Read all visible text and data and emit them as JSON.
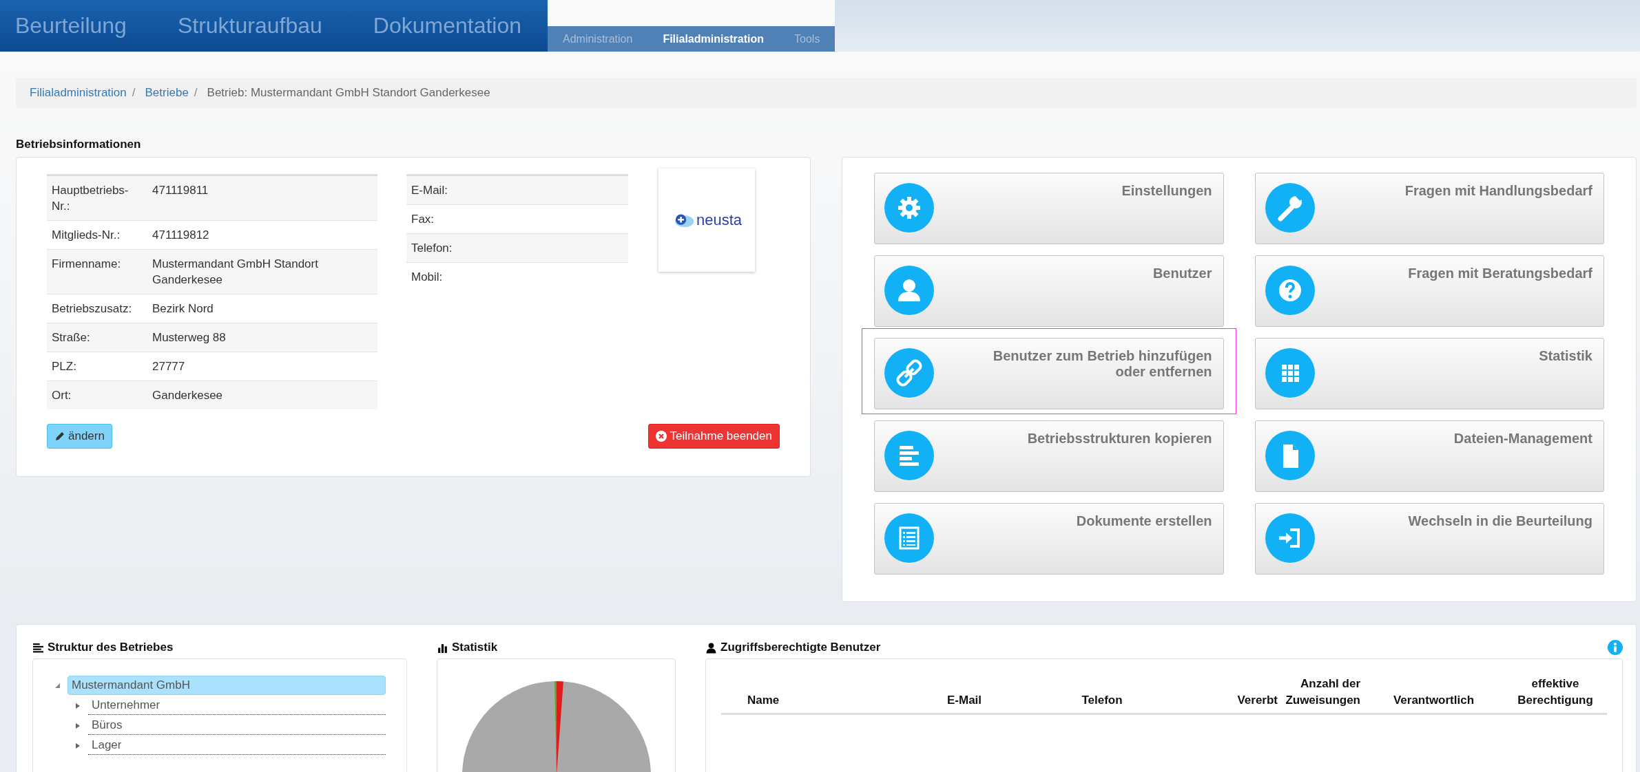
{
  "top_nav": [
    {
      "label": "Beurteilung",
      "selected": false
    },
    {
      "label": "Strukturaufbau",
      "selected": false
    },
    {
      "label": "Dokumentation",
      "selected": false
    }
  ],
  "sub_nav": [
    {
      "label": "Administration",
      "selected": false
    },
    {
      "label": "Filialadministration",
      "selected": true
    },
    {
      "label": "Tools",
      "selected": false
    }
  ],
  "breadcrumb": [
    {
      "label": "Filialadministration",
      "kind": "link"
    },
    {
      "label": "/",
      "kind": "separator"
    },
    {
      "label": "Betriebe",
      "kind": "link"
    },
    {
      "label": "/",
      "kind": "separator"
    },
    {
      "label": "Betrieb: Mustermandant GmbH Standort Ganderkesee",
      "kind": "current"
    }
  ],
  "info_section": {
    "title": "Betriebsinformationen",
    "left_fields": [
      {
        "label": "Hauptbetriebs-Nr.:",
        "value": "471119811"
      },
      {
        "label": "Mitglieds-Nr.:",
        "value": "471119812"
      },
      {
        "label": "Firmenname:",
        "value": "Mustermandant GmbH Standort Ganderkesee"
      },
      {
        "label": "Betriebszusatz:",
        "value": "Bezirk Nord"
      },
      {
        "label": "Straße:",
        "value": "Musterweg 88"
      },
      {
        "label": "PLZ:",
        "value": "27777"
      },
      {
        "label": "Ort:",
        "value": "Ganderkesee"
      }
    ],
    "right_fields": [
      {
        "label": "E-Mail:"
      },
      {
        "label": "Fax:"
      },
      {
        "label": "Telefon:"
      },
      {
        "label": "Mobil:"
      }
    ],
    "logo_text": "neusta",
    "edit_button": "ändern",
    "end_button": "Teilnahme beenden"
  },
  "tiles": [
    {
      "label": "Einstellungen",
      "kind": "gear",
      "highlighted": false
    },
    {
      "label": "Fragen mit Handlungsbedarf",
      "kind": "wrench",
      "highlighted": false
    },
    {
      "label": "Benutzer",
      "kind": "user",
      "highlighted": false
    },
    {
      "label": "Fragen mit Beratungsbedarf",
      "kind": "question",
      "highlighted": false
    },
    {
      "label": "Benutzer zum Betrieb hinzufügen oder entfernen",
      "kind": "link",
      "highlighted": true
    },
    {
      "label": "Statistik",
      "kind": "grid",
      "highlighted": false
    },
    {
      "label": "Betriebsstrukturen kopieren",
      "kind": "lines",
      "highlighted": false
    },
    {
      "label": "Dateien-Management",
      "kind": "file",
      "highlighted": false
    },
    {
      "label": "Dokumente erstellen",
      "kind": "list",
      "highlighted": false
    },
    {
      "label": "Wechseln in die Beurteilung",
      "kind": "enter",
      "highlighted": false
    }
  ],
  "structure_panel": {
    "title": "Struktur des Betriebes",
    "tree": [
      {
        "label": "Mustermandant GmbH",
        "expanded": true,
        "selected": true,
        "children": [
          {
            "label": "Unternehmer",
            "expanded": false,
            "selected": false
          },
          {
            "label": "Büros",
            "expanded": false,
            "selected": false
          },
          {
            "label": "Lager",
            "expanded": false,
            "selected": false
          }
        ]
      }
    ]
  },
  "statistics_panel": {
    "title": "Statistik"
  },
  "users_panel": {
    "title": "Zugriffsberechtigte Benutzer",
    "columns": [
      "Name",
      "E-Mail",
      "Telefon",
      "Vererbt",
      "Anzahl der Zuweisungen",
      "Verantwortlich",
      "effektive Berechtigung"
    ]
  }
}
